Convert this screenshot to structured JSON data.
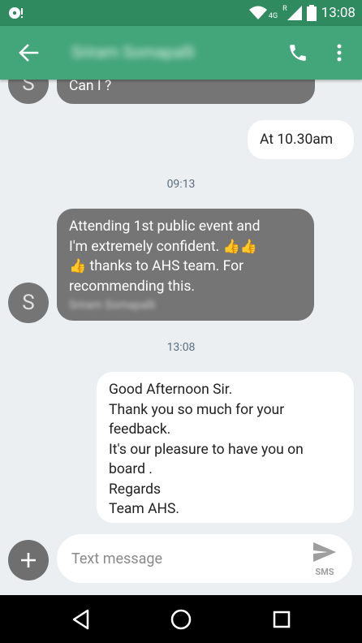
{
  "status_bar": {
    "time": "13:08",
    "network": "4G",
    "roaming": "R"
  },
  "app_bar": {
    "contact_name": "Sriram Somapalli"
  },
  "messages": [
    {
      "direction": "in",
      "text": "Can I ?"
    },
    {
      "direction": "out",
      "text": "At 10.30am"
    },
    {
      "type": "timestamp",
      "text": "09:13"
    },
    {
      "direction": "in",
      "line1": "Attending 1st public event and",
      "line2": "I'm extremely confident.",
      "line3": "thanks to AHS team. For",
      "line4": "recommending this.",
      "sender": "Sriram Somapalli",
      "avatar_letter": "S"
    },
    {
      "type": "timestamp",
      "text": "13:08"
    },
    {
      "direction": "out",
      "lines": [
        "Good Afternoon Sir.",
        "Thank you so much for your",
        "feedback.",
        "It's our pleasure to have you on",
        "board .",
        "Regards",
        "Team AHS."
      ]
    }
  ],
  "avatar_top_letter": "S",
  "compose": {
    "placeholder": "Text message",
    "send_label": "SMS"
  },
  "colors": {
    "app_bar": "#43a57a",
    "status_bar": "#2f8a5f",
    "incoming_bubble": "#757575",
    "outgoing_bubble": "#ffffff",
    "background": "#eceff1"
  }
}
